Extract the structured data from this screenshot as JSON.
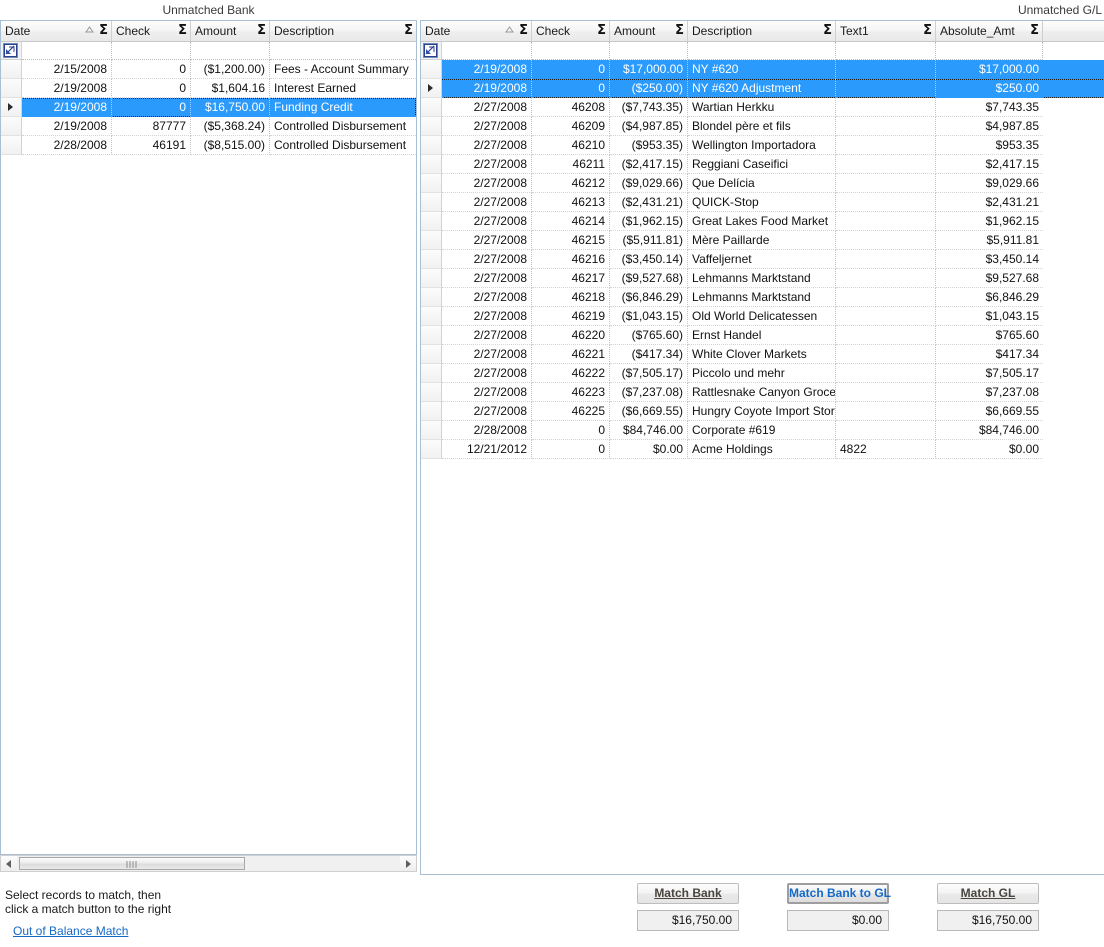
{
  "left_panel": {
    "title": "Unmatched Bank",
    "columns": [
      {
        "label": "Date",
        "align": "r",
        "sorted": true
      },
      {
        "label": "Check",
        "align": "r",
        "sorted": false
      },
      {
        "label": "Amount",
        "align": "r",
        "sorted": false
      },
      {
        "label": "Description",
        "align": "l",
        "sorted": false
      }
    ],
    "rows": [
      {
        "date": "2/15/2008",
        "check": "0",
        "amount": "($1,200.00)",
        "description": "Fees - Account Summary",
        "selected": false,
        "indicator": false
      },
      {
        "date": "2/19/2008",
        "check": "0",
        "amount": "$1,604.16",
        "description": "Interest Earned",
        "selected": false,
        "indicator": false
      },
      {
        "date": "2/19/2008",
        "check": "0",
        "amount": "$16,750.00",
        "description": "Funding Credit",
        "selected": true,
        "indicator": true
      },
      {
        "date": "2/19/2008",
        "check": "87777",
        "amount": "($5,368.24)",
        "description": "Controlled Disbursement",
        "selected": false,
        "indicator": false
      },
      {
        "date": "2/28/2008",
        "check": "46191",
        "amount": "($8,515.00)",
        "description": "Controlled Disbursement",
        "selected": false,
        "indicator": false
      }
    ],
    "scrollbar": {
      "left_arrow": "left-arrow",
      "right_arrow": "right-arrow"
    }
  },
  "right_panel": {
    "title": "Unmatched G/L",
    "columns": [
      {
        "label": "Date",
        "align": "r",
        "sorted": true
      },
      {
        "label": "Check",
        "align": "r",
        "sorted": false
      },
      {
        "label": "Amount",
        "align": "r",
        "sorted": false
      },
      {
        "label": "Description",
        "align": "l",
        "sorted": false
      },
      {
        "label": "Text1",
        "align": "l",
        "sorted": false
      },
      {
        "label": "Absolute_Amt",
        "align": "r",
        "sorted": false
      }
    ],
    "rows": [
      {
        "date": "2/19/2008",
        "check": "0",
        "amount": "$17,000.00",
        "description": "NY #620",
        "text1": "",
        "absolute_amt": "$17,000.00",
        "selected": true,
        "indicator": false
      },
      {
        "date": "2/19/2008",
        "check": "0",
        "amount": "($250.00)",
        "description": "NY #620 Adjustment",
        "text1": "",
        "absolute_amt": "$250.00",
        "selected": true,
        "indicator": true
      },
      {
        "date": "2/27/2008",
        "check": "46208",
        "amount": "($7,743.35)",
        "description": "Wartian Herkku",
        "text1": "",
        "absolute_amt": "$7,743.35",
        "selected": false,
        "indicator": false
      },
      {
        "date": "2/27/2008",
        "check": "46209",
        "amount": "($4,987.85)",
        "description": "Blondel père et fils",
        "text1": "",
        "absolute_amt": "$4,987.85",
        "selected": false,
        "indicator": false
      },
      {
        "date": "2/27/2008",
        "check": "46210",
        "amount": "($953.35)",
        "description": "Wellington Importadora",
        "text1": "",
        "absolute_amt": "$953.35",
        "selected": false,
        "indicator": false
      },
      {
        "date": "2/27/2008",
        "check": "46211",
        "amount": "($2,417.15)",
        "description": "Reggiani Caseifici",
        "text1": "",
        "absolute_amt": "$2,417.15",
        "selected": false,
        "indicator": false
      },
      {
        "date": "2/27/2008",
        "check": "46212",
        "amount": "($9,029.66)",
        "description": "Que Delícia",
        "text1": "",
        "absolute_amt": "$9,029.66",
        "selected": false,
        "indicator": false
      },
      {
        "date": "2/27/2008",
        "check": "46213",
        "amount": "($2,431.21)",
        "description": "QUICK-Stop",
        "text1": "",
        "absolute_amt": "$2,431.21",
        "selected": false,
        "indicator": false
      },
      {
        "date": "2/27/2008",
        "check": "46214",
        "amount": "($1,962.15)",
        "description": "Great Lakes Food Market",
        "text1": "",
        "absolute_amt": "$1,962.15",
        "selected": false,
        "indicator": false
      },
      {
        "date": "2/27/2008",
        "check": "46215",
        "amount": "($5,911.81)",
        "description": "Mère Paillarde",
        "text1": "",
        "absolute_amt": "$5,911.81",
        "selected": false,
        "indicator": false
      },
      {
        "date": "2/27/2008",
        "check": "46216",
        "amount": "($3,450.14)",
        "description": "Vaffeljernet",
        "text1": "",
        "absolute_amt": "$3,450.14",
        "selected": false,
        "indicator": false
      },
      {
        "date": "2/27/2008",
        "check": "46217",
        "amount": "($9,527.68)",
        "description": "Lehmanns Marktstand",
        "text1": "",
        "absolute_amt": "$9,527.68",
        "selected": false,
        "indicator": false
      },
      {
        "date": "2/27/2008",
        "check": "46218",
        "amount": "($6,846.29)",
        "description": "Lehmanns Marktstand",
        "text1": "",
        "absolute_amt": "$6,846.29",
        "selected": false,
        "indicator": false
      },
      {
        "date": "2/27/2008",
        "check": "46219",
        "amount": "($1,043.15)",
        "description": "Old World Delicatessen",
        "text1": "",
        "absolute_amt": "$1,043.15",
        "selected": false,
        "indicator": false
      },
      {
        "date": "2/27/2008",
        "check": "46220",
        "amount": "($765.60)",
        "description": "Ernst Handel",
        "text1": "",
        "absolute_amt": "$765.60",
        "selected": false,
        "indicator": false
      },
      {
        "date": "2/27/2008",
        "check": "46221",
        "amount": "($417.34)",
        "description": "White Clover Markets",
        "text1": "",
        "absolute_amt": "$417.34",
        "selected": false,
        "indicator": false
      },
      {
        "date": "2/27/2008",
        "check": "46222",
        "amount": "($7,505.17)",
        "description": "Piccolo und mehr",
        "text1": "",
        "absolute_amt": "$7,505.17",
        "selected": false,
        "indicator": false
      },
      {
        "date": "2/27/2008",
        "check": "46223",
        "amount": "($7,237.08)",
        "description": "Rattlesnake Canyon Groce...",
        "text1": "",
        "absolute_amt": "$7,237.08",
        "selected": false,
        "indicator": false
      },
      {
        "date": "2/27/2008",
        "check": "46225",
        "amount": "($6,669.55)",
        "description": "Hungry Coyote Import Store",
        "text1": "",
        "absolute_amt": "$6,669.55",
        "selected": false,
        "indicator": false
      },
      {
        "date": "2/28/2008",
        "check": "0",
        "amount": "$84,746.00",
        "description": "Corporate #619",
        "text1": "",
        "absolute_amt": "$84,746.00",
        "selected": false,
        "indicator": false
      },
      {
        "date": "12/21/2012",
        "check": "0",
        "amount": "$0.00",
        "description": "Acme Holdings",
        "text1": "4822",
        "absolute_amt": "$0.00",
        "selected": false,
        "indicator": false
      }
    ]
  },
  "footer": {
    "hint_line1": "Select records to match, then",
    "hint_line2": "click a match button to the right",
    "out_of_balance_link": "Out of Balance Match",
    "actions": [
      {
        "label": "Match Bank",
        "value": "$16,750.00",
        "primary": false
      },
      {
        "label": "Match Bank to GL",
        "value": "$0.00",
        "primary": true
      },
      {
        "label": "Match GL",
        "value": "$16,750.00",
        "primary": false
      }
    ]
  },
  "icons": {
    "sigma": "Σ",
    "sort_asc": "▲",
    "filter_editor": "filter-editor-icon"
  },
  "colors": {
    "selection_blue": "#2a9afd",
    "link_blue": "#1569c7",
    "grid_border": "#a9c0d4",
    "header_text": "#1a1a1a"
  }
}
